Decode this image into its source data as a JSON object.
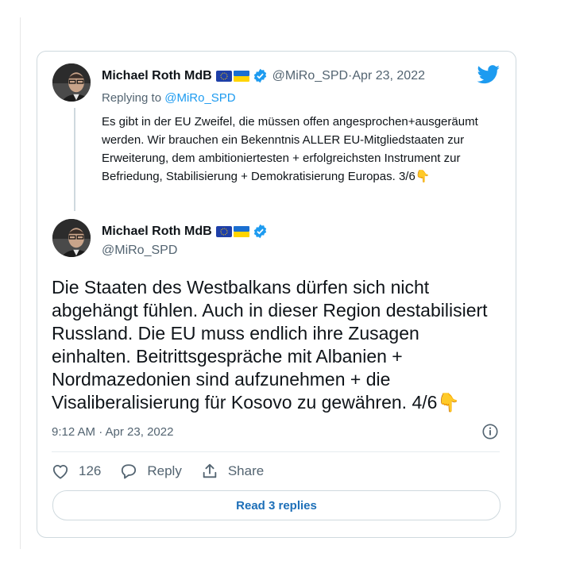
{
  "quoted_tweet": {
    "name": "Michael Roth MdB",
    "handle": "@MiRo_SPD",
    "date_sep": " · ",
    "date": "Apr 23, 2022",
    "replying_prefix": "Replying to ",
    "replying_handle": "@MiRo_SPD",
    "text": "Es gibt in der EU Zweifel, die müssen offen angesprochen+ausgeräumt werden. Wir brauchen ein Bekenntnis ALLER EU-Mitgliedstaaten zur Erweiterung, dem ambitioniertesten + erfolgreichsten Instrument zur Befriedung, Stabilisierung + Demokratisierung Europas. 3/6",
    "emoji": "👇"
  },
  "main_tweet": {
    "name": "Michael Roth MdB",
    "handle": "@MiRo_SPD",
    "text": "Die Staaten des Westbalkans dürfen sich nicht abgehängt fühlen. Auch in dieser Region destabilisiert Russland. Die EU muss endlich ihre Zusagen einhalten. Beitrittsgespräche mit Albanien + Nordmazedonien sind aufzunehmen + die Visaliberalisierung für Kosovo zu gewähren. 4/6",
    "emoji": "👇",
    "timestamp": "9:12 AM · Apr 23, 2022"
  },
  "actions": {
    "like_count": "126",
    "reply_label": "Reply",
    "share_label": "Share"
  },
  "read_replies_label": "Read 3 replies",
  "icons": {
    "brand": "twitter-bird-icon",
    "verified": "verified-badge-icon",
    "flags": [
      "eu-flag-icon",
      "ukraine-flag-icon"
    ],
    "info": "info-icon",
    "like": "heart-icon",
    "reply": "speech-bubble-icon",
    "share": "share-icon"
  },
  "colors": {
    "accent": "#1d9bf0",
    "muted": "#536471",
    "border": "#cfd9de"
  }
}
